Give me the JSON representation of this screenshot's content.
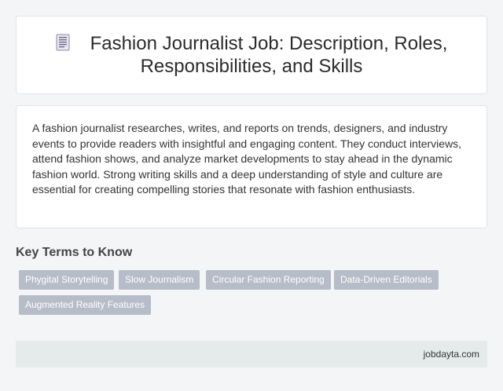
{
  "header": {
    "icon": "document-icon",
    "title": "Fashion Journalist Job: Description, Roles, Responsibilities, and Skills"
  },
  "description": {
    "text": "A fashion journalist researches, writes, and reports on trends, designers, and industry events to provide readers with insightful and engaging content. They conduct interviews, attend fashion shows, and analyze market developments to stay ahead in the dynamic fashion world. Strong writing skills and a deep understanding of style and culture are essential for creating compelling stories that resonate with fashion enthusiasts."
  },
  "key_terms": {
    "heading": "Key Terms to Know",
    "tags": [
      "Phygital Storytelling",
      "Slow Journalism",
      "Circular Fashion Reporting",
      "Data-Driven Editorials",
      "Augmented Reality Features"
    ]
  },
  "footer": {
    "source": "jobdayta.com"
  },
  "colors": {
    "tag_background": "#b7bcc9",
    "footer_background": "#e5ebeb",
    "page_background": "#f4f5f7"
  }
}
